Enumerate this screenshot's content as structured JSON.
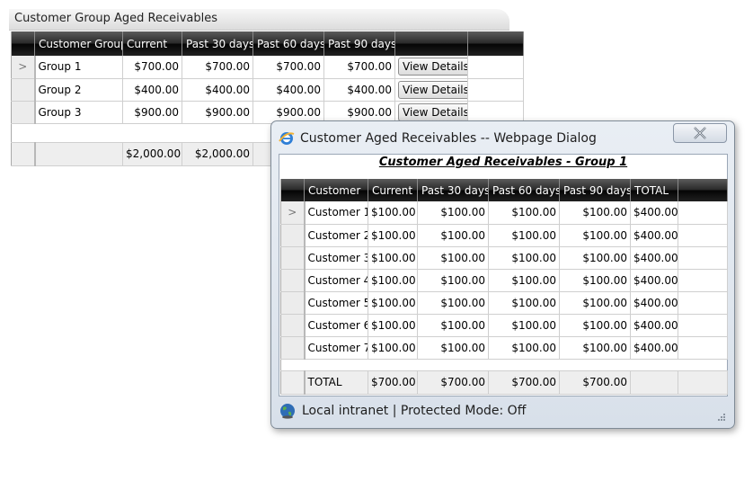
{
  "page": {
    "title": "Customer Group Aged Receivables",
    "columns": [
      "Customer Group",
      "Current",
      "Past 30 days",
      "Past 60 days",
      "Past 90 days"
    ],
    "rows": [
      {
        "name": "Group 1",
        "current": "$700.00",
        "p30": "$700.00",
        "p60": "$700.00",
        "p90": "$700.00",
        "action": "View Details"
      },
      {
        "name": "Group 2",
        "current": "$400.00",
        "p30": "$400.00",
        "p60": "$400.00",
        "p90": "$400.00",
        "action": "View Details"
      },
      {
        "name": "Group 3",
        "current": "$900.00",
        "p30": "$900.00",
        "p60": "$900.00",
        "p90": "$900.00",
        "action": "View Details"
      }
    ],
    "selected_marker": ">",
    "footer": {
      "current": "$2,000.00",
      "p30": "$2,000.00"
    }
  },
  "dialog": {
    "title": "Customer Aged Receivables -- Webpage Dialog",
    "heading": "Customer Aged Receivables - Group 1",
    "columns": [
      "Customer",
      "Current",
      "Past 30 days",
      "Past 60 days",
      "Past 90 days",
      "TOTAL"
    ],
    "rows": [
      {
        "name": "Customer 1",
        "current": "$100.00",
        "p30": "$100.00",
        "p60": "$100.00",
        "p90": "$100.00",
        "total": "$400.00"
      },
      {
        "name": "Customer 2",
        "current": "$100.00",
        "p30": "$100.00",
        "p60": "$100.00",
        "p90": "$100.00",
        "total": "$400.00"
      },
      {
        "name": "Customer 3",
        "current": "$100.00",
        "p30": "$100.00",
        "p60": "$100.00",
        "p90": "$100.00",
        "total": "$400.00"
      },
      {
        "name": "Customer 4",
        "current": "$100.00",
        "p30": "$100.00",
        "p60": "$100.00",
        "p90": "$100.00",
        "total": "$400.00"
      },
      {
        "name": "Customer 5",
        "current": "$100.00",
        "p30": "$100.00",
        "p60": "$100.00",
        "p90": "$100.00",
        "total": "$400.00"
      },
      {
        "name": "Customer 6",
        "current": "$100.00",
        "p30": "$100.00",
        "p60": "$100.00",
        "p90": "$100.00",
        "total": "$400.00"
      },
      {
        "name": "Customer 7",
        "current": "$100.00",
        "p30": "$100.00",
        "p60": "$100.00",
        "p90": "$100.00",
        "total": "$400.00"
      }
    ],
    "footer": {
      "label": "TOTAL",
      "current": "$700.00",
      "p30": "$700.00",
      "p60": "$700.00",
      "p90": "$700.00"
    },
    "status": "Local intranet | Protected Mode: Off",
    "icons": {
      "title": "ie-icon",
      "close": "close-icon",
      "status": "globe-icon",
      "grip": "resize-grip-icon"
    }
  },
  "colors": {
    "header_dark": "#050505",
    "dialog_frame": "#d8e0ea",
    "selector": "#ececec"
  }
}
